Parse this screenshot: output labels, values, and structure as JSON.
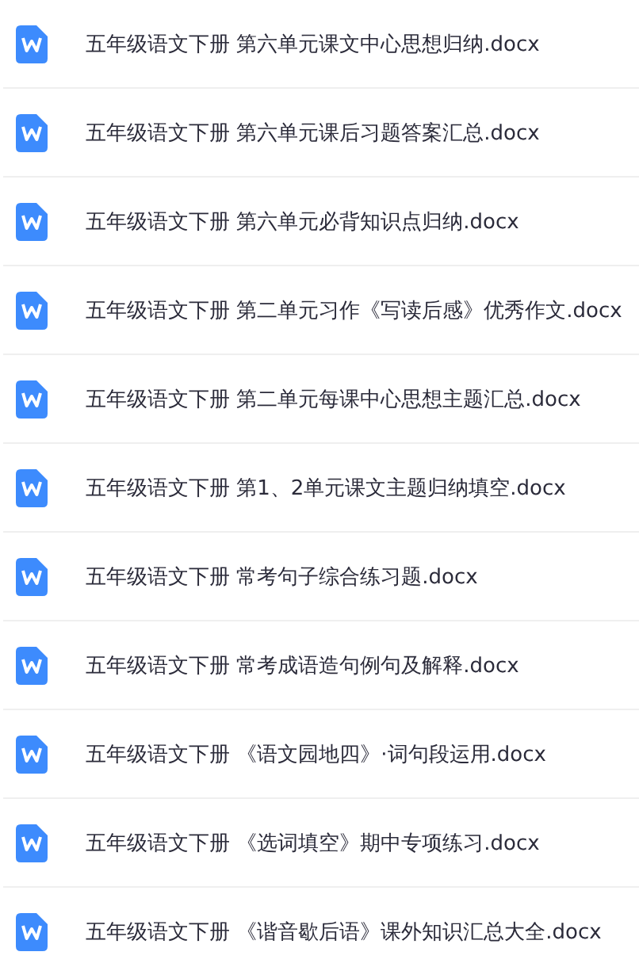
{
  "files": [
    {
      "name": "五年级语文下册 第六单元课文中心思想归纳.docx"
    },
    {
      "name": "五年级语文下册 第六单元课后习题答案汇总.docx"
    },
    {
      "name": "五年级语文下册 第六单元必背知识点归纳.docx"
    },
    {
      "name": "五年级语文下册 第二单元习作《写读后感》优秀作文.docx"
    },
    {
      "name": "五年级语文下册 第二单元每课中心思想主题汇总.docx"
    },
    {
      "name": "五年级语文下册 第1、2单元课文主题归纳填空.docx"
    },
    {
      "name": "五年级语文下册 常考句子综合练习题.docx"
    },
    {
      "name": "五年级语文下册 常考成语造句例句及解释.docx"
    },
    {
      "name": "五年级语文下册 《语文园地四》·词句段运用.docx"
    },
    {
      "name": "五年级语文下册 《选词填空》期中专项练习.docx"
    },
    {
      "name": "五年级语文下册 《谐音歇后语》课外知识汇总大全.docx"
    }
  ]
}
